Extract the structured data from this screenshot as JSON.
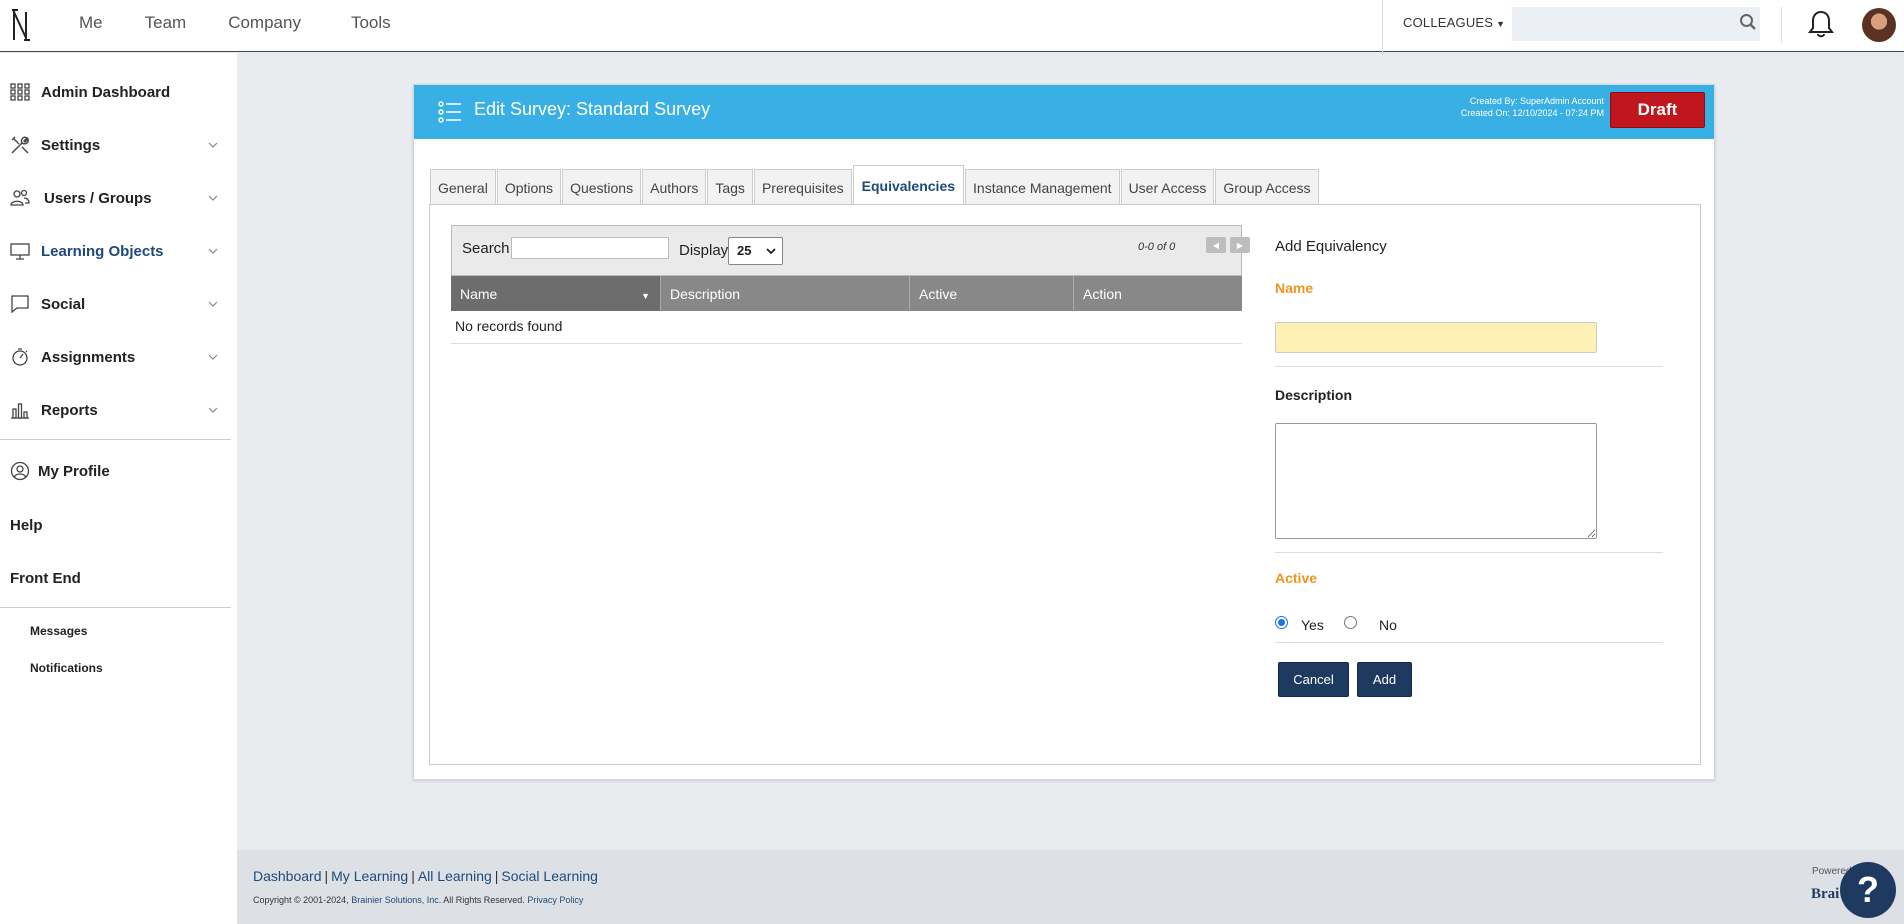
{
  "topnav": {
    "items": [
      "Me",
      "Team",
      "Company",
      "Tools"
    ],
    "colleagues_label": "COLLEAGUES"
  },
  "sidebar": {
    "items": [
      {
        "label": "Admin Dashboard",
        "icon": "grid-icon"
      },
      {
        "label": "Settings",
        "icon": "tools-icon"
      },
      {
        "label": "Users / Groups",
        "icon": "users-icon"
      },
      {
        "label": "Learning Objects",
        "icon": "monitor-icon"
      },
      {
        "label": "Social",
        "icon": "chat-icon"
      },
      {
        "label": "Assignments",
        "icon": "stopwatch-icon"
      },
      {
        "label": "Reports",
        "icon": "bar-chart-icon"
      }
    ],
    "my_profile": "My Profile",
    "help": "Help",
    "front_end": "Front End",
    "messages": "Messages",
    "notifications": "Notifications"
  },
  "panel": {
    "title": "Edit Survey: Standard Survey",
    "created_by": "Created By: SuperAdmin Account",
    "created_on": "Created On: 12/10/2024 - 07:24 PM",
    "status_button": "Draft",
    "tabs": [
      "General",
      "Options",
      "Questions",
      "Authors",
      "Tags",
      "Prerequisites",
      "Equivalencies",
      "Instance Management",
      "User Access",
      "Group Access"
    ],
    "active_tab": "Equivalencies"
  },
  "table": {
    "search_label": "Search",
    "display_label": "Display",
    "display_value": "25",
    "pager_text": "0-0 of 0",
    "columns": [
      "Name",
      "Description",
      "Active",
      "Action"
    ],
    "empty_text": "No records found"
  },
  "form": {
    "title": "Add Equivalency",
    "name_label": "Name",
    "description_label": "Description",
    "active_label": "Active",
    "yes_label": "Yes",
    "no_label": "No",
    "cancel_label": "Cancel",
    "add_label": "Add"
  },
  "footer": {
    "links": [
      "Dashboard",
      "My Learning",
      "All Learning",
      "Social Learning"
    ],
    "copyright_prefix": "Copyright © 2001-2024,",
    "company": "Brainier Solutions, Inc.",
    "rights": "All Rights Reserved.",
    "privacy": "Privacy Policy",
    "powered": "Powered",
    "brand": "Brai"
  },
  "help_bubble": "?",
  "colors": {
    "header_blue": "#39b0e5",
    "draft_red": "#c0171f",
    "navy": "#1f3a60",
    "orange_label": "#f0931f"
  }
}
